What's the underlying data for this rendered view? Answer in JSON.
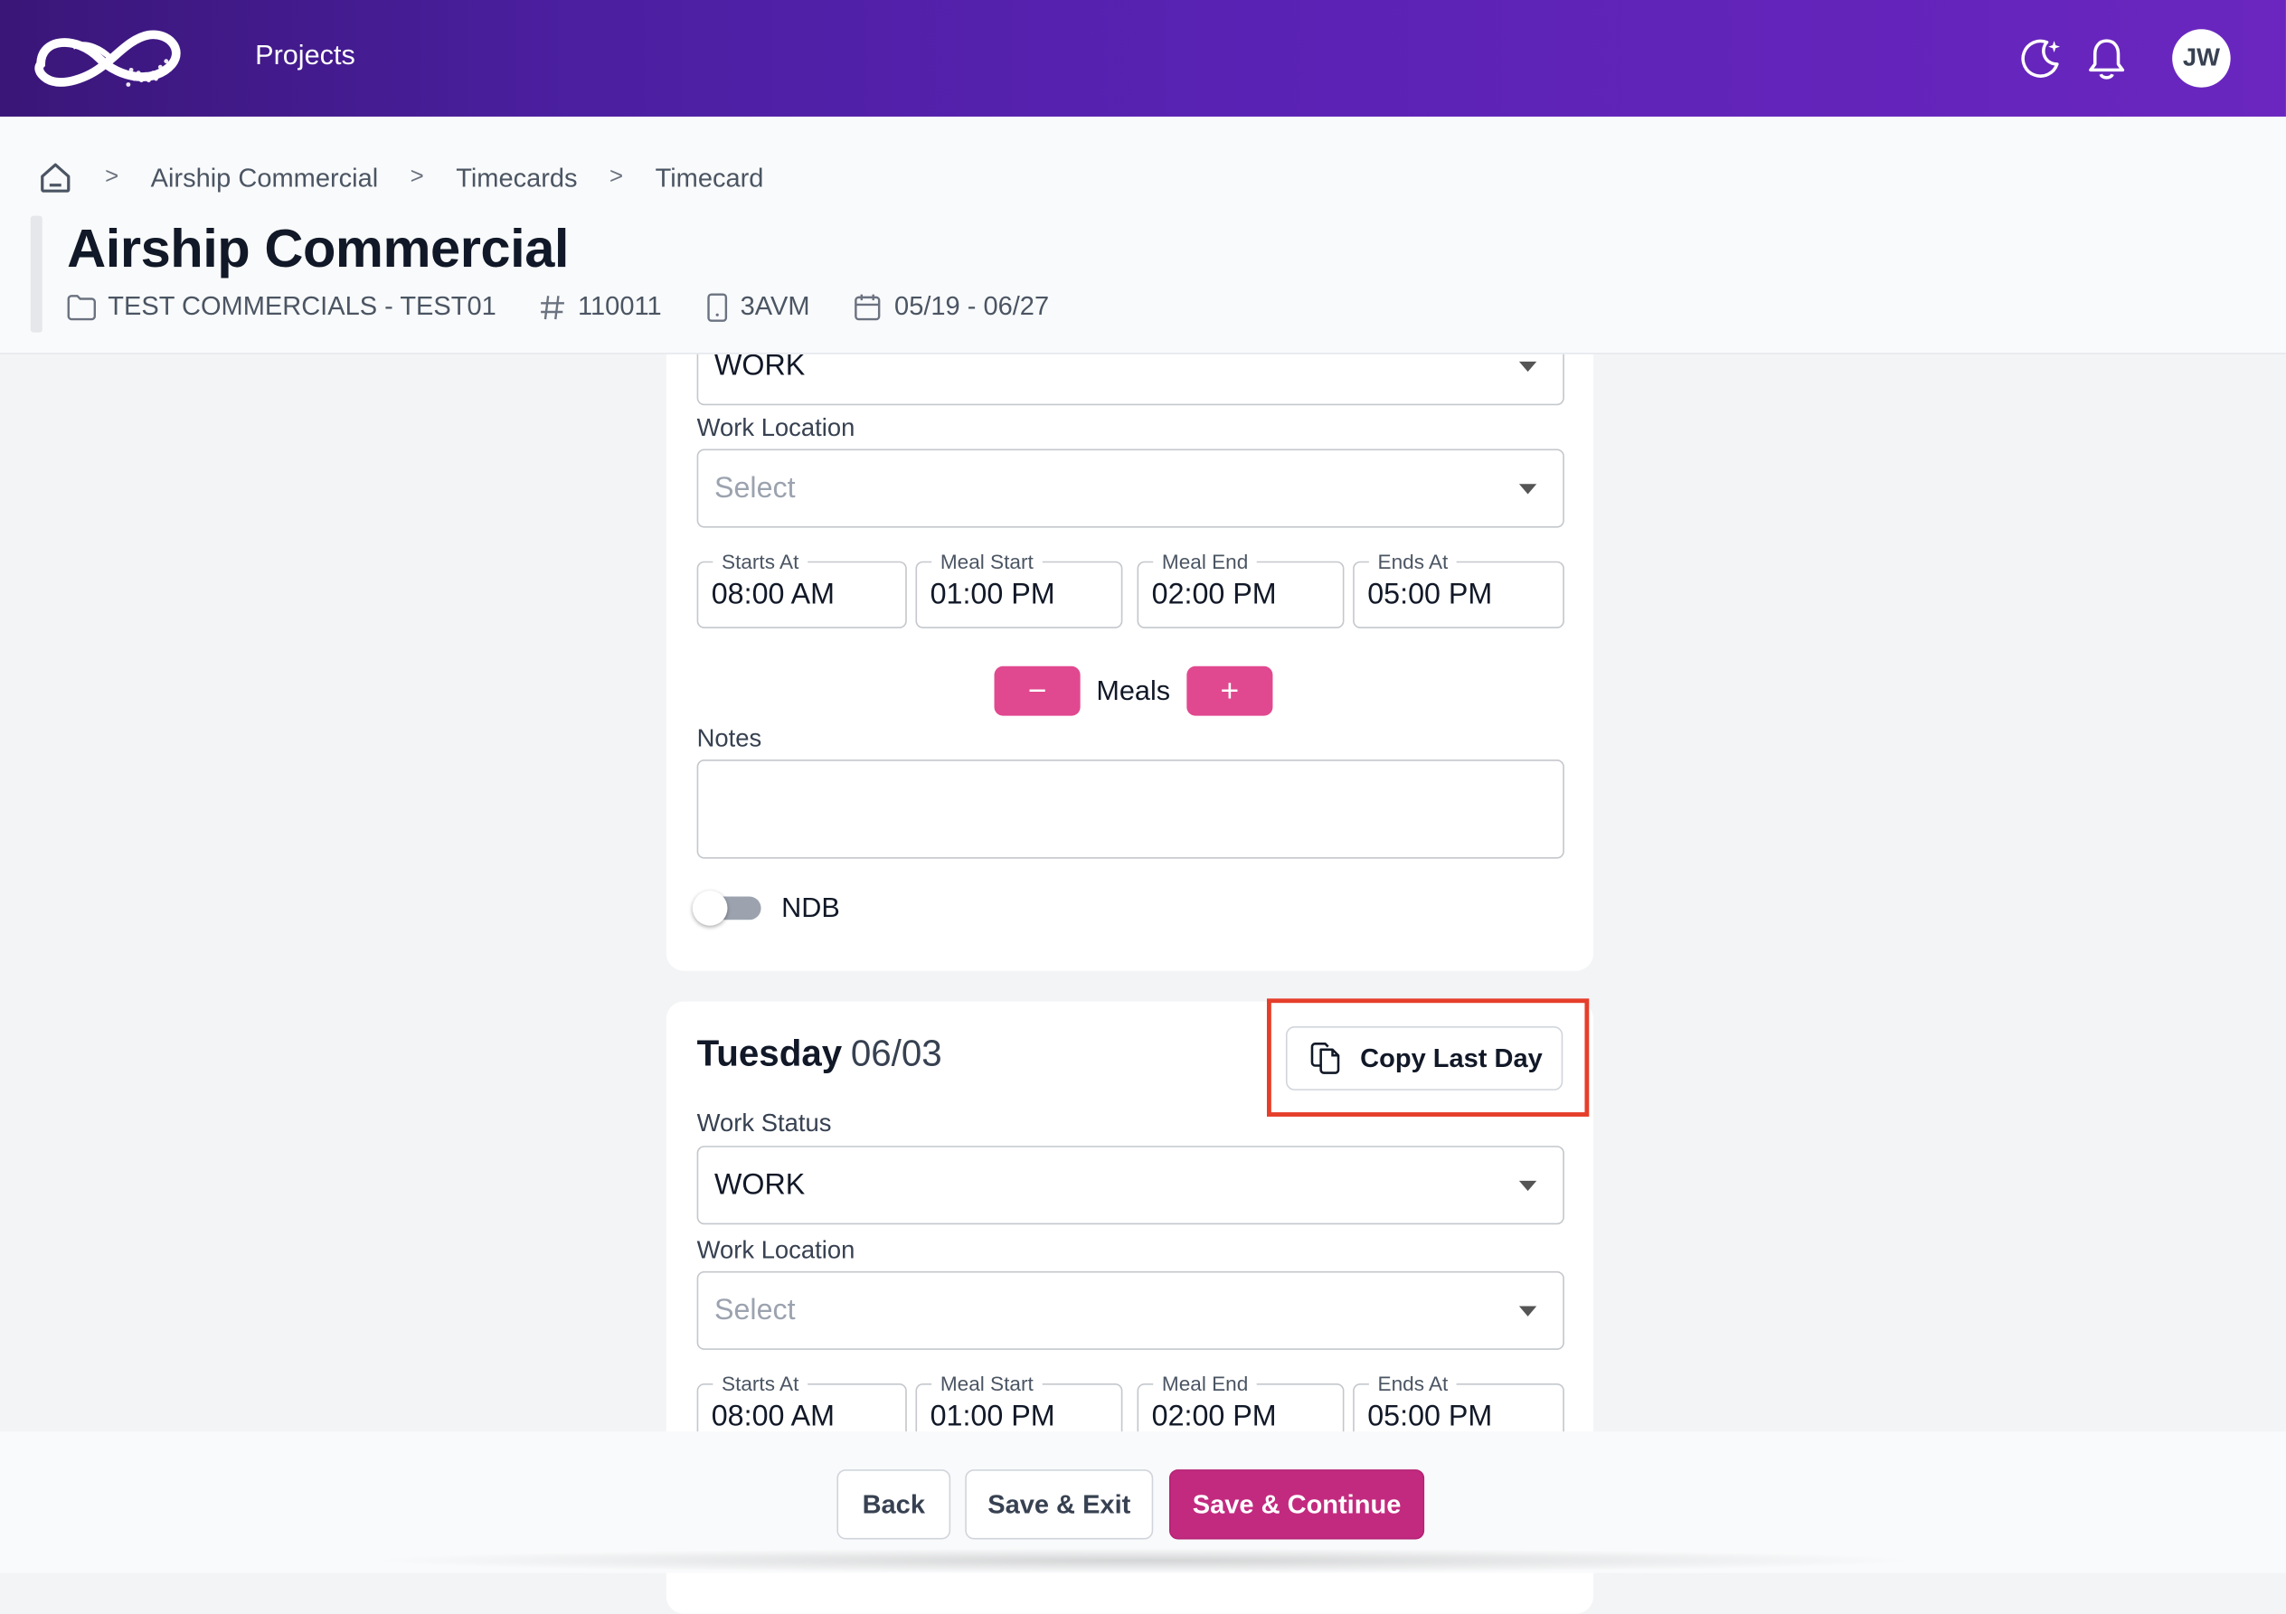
{
  "nav": {
    "projects_label": "Projects",
    "avatar_initials": "JW"
  },
  "breadcrumb": {
    "items": [
      "Airship Commercial",
      "Timecards",
      "Timecard"
    ]
  },
  "project": {
    "title": "Airship Commercial",
    "folder": "TEST COMMERCIALS - TEST01",
    "number": "110011",
    "code": "3AVM",
    "date_range": "05/19 - 06/27"
  },
  "day1": {
    "work_status_value": "WORK",
    "work_location_label": "Work Location",
    "work_location_placeholder": "Select",
    "times": [
      {
        "label": "Starts At",
        "value": "08:00 AM"
      },
      {
        "label": "Meal Start",
        "value": "01:00 PM"
      },
      {
        "label": "Meal End",
        "value": "02:00 PM"
      },
      {
        "label": "Ends At",
        "value": "05:00 PM"
      }
    ],
    "meals_label": "Meals",
    "meals_minus": "−",
    "meals_plus": "+",
    "notes_label": "Notes",
    "ndb_label": "NDB"
  },
  "day2": {
    "day_name": "Tuesday",
    "date": "06/03",
    "copy_label": "Copy Last Day",
    "work_status_label": "Work Status",
    "work_status_value": "WORK",
    "work_location_label": "Work Location",
    "work_location_placeholder": "Select",
    "times": [
      {
        "label": "Starts At",
        "value": "08:00 AM"
      },
      {
        "label": "Meal Start",
        "value": "01:00 PM"
      },
      {
        "label": "Meal End",
        "value": "02:00 PM"
      },
      {
        "label": "Ends At",
        "value": "05:00 PM"
      }
    ]
  },
  "footer": {
    "back_label": "Back",
    "save_exit_label": "Save & Exit",
    "save_continue_label": "Save & Continue"
  },
  "colors": {
    "accent_pink": "#c22a7f",
    "meal_button": "#e0498f",
    "highlight": "#e53e2a",
    "topbar": "#5a22b4"
  }
}
